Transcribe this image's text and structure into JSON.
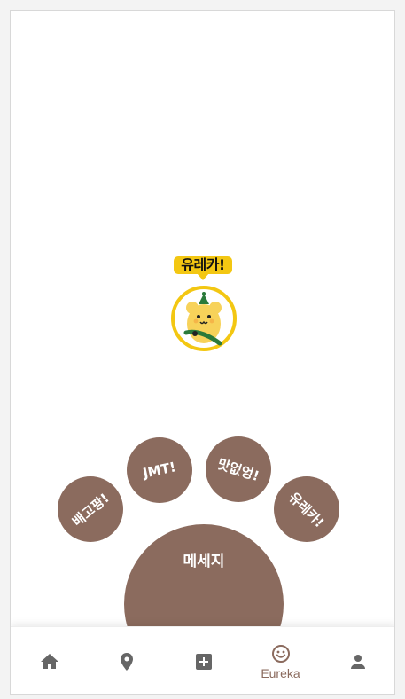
{
  "character": {
    "bubble_text": "유레카!",
    "icon": "bear-character-icon",
    "ring_color": "#f3c712"
  },
  "paw": {
    "color": "#8b6b5e",
    "toes": [
      {
        "label": "배고팡!"
      },
      {
        "label": "JMT!"
      },
      {
        "label": "맛없엉!"
      },
      {
        "label": "유레카!"
      }
    ],
    "pad_label": "메세지"
  },
  "nav": {
    "items": [
      {
        "icon": "home-icon",
        "label": ""
      },
      {
        "icon": "location-pin-icon",
        "label": ""
      },
      {
        "icon": "add-box-icon",
        "label": ""
      },
      {
        "icon": "smiley-icon",
        "label": "Eureka",
        "active": true
      },
      {
        "icon": "person-icon",
        "label": ""
      }
    ],
    "icon_color": "#666666",
    "active_color": "#8b6b5e"
  }
}
